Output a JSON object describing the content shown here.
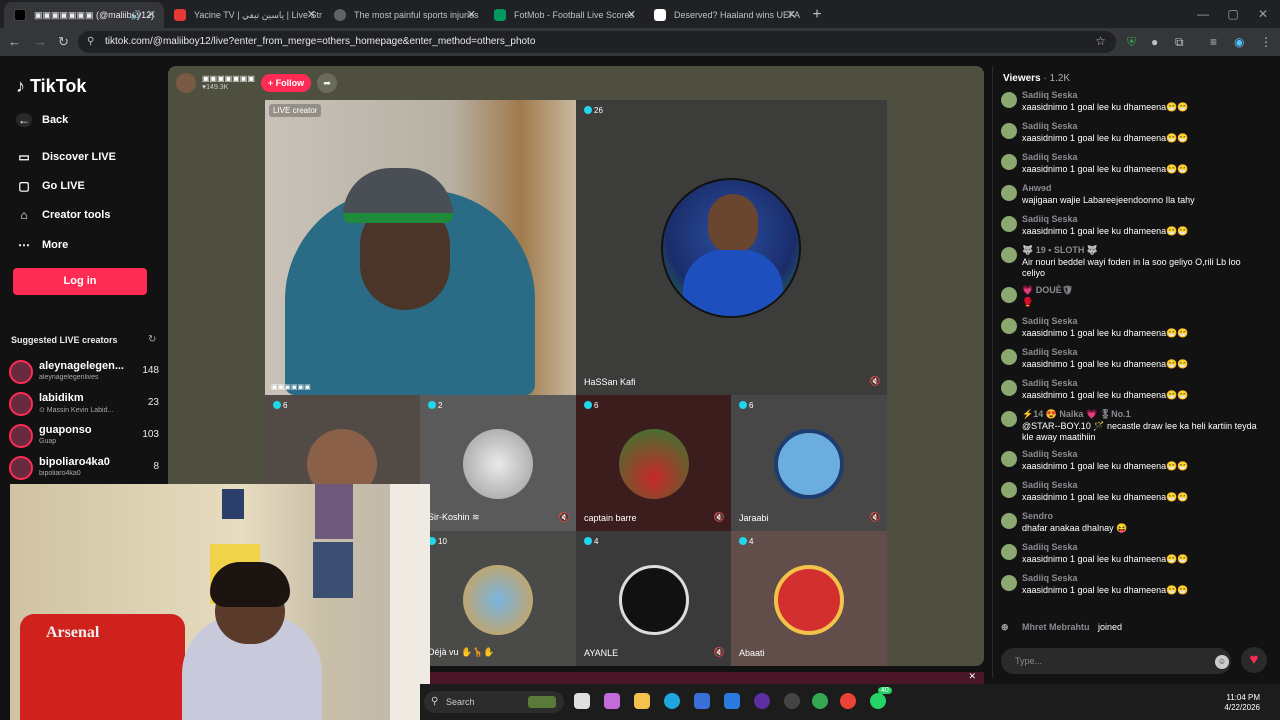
{
  "browser": {
    "tabs": [
      {
        "title": "▣▣▣▣▣▣▣ (@maliiboy12)",
        "color": "#000000",
        "active": true
      },
      {
        "title": "Yacine TV | ياسين تيفي | Live Str",
        "color": "#e53935",
        "active": false
      },
      {
        "title": "The most painful sports injuries",
        "color": "#5f6368",
        "active": false
      },
      {
        "title": "FotMob - Football Live Scores",
        "color": "#00985f",
        "active": false
      },
      {
        "title": "Deserved? Haaland wins UEFA",
        "color": "#ffffff",
        "active": false
      }
    ],
    "url": "tiktok.com/@maliiboy12/live?enter_from_merge=others_homepage&enter_method=others_photo"
  },
  "sidebar": {
    "logo": "TikTok",
    "back": "Back",
    "items": [
      {
        "label": "Discover LIVE",
        "icon": "tv-icon"
      },
      {
        "label": "Go LIVE",
        "icon": "camera-icon"
      },
      {
        "label": "Creator tools",
        "icon": "home-icon"
      },
      {
        "label": "More",
        "icon": "dots-icon"
      }
    ],
    "login": "Log in",
    "suggested_title": "Suggested LIVE creators",
    "suggested": [
      {
        "name": "aleynagelegen...",
        "sub": "aleynagelegenlives",
        "count": "148"
      },
      {
        "name": "labidikm",
        "sub": "⊙ Massin Kevin Labid...",
        "count": "23"
      },
      {
        "name": "guaponso",
        "sub": "Guap",
        "count": "103"
      },
      {
        "name": "bipoliaro4ka0",
        "sub": "bipoliaro4ka0",
        "count": "8"
      }
    ]
  },
  "live": {
    "host_name": "▣▣▣▣▣▣▣",
    "host_likes": "♥149.3K",
    "follow": "+ Follow",
    "creator_badge": "LIVE creator",
    "creator_name": "▣▣▣▣▣▣",
    "guests": [
      {
        "count": "26",
        "name": "HaSSan Kafi"
      },
      {
        "count": "6",
        "name": ""
      },
      {
        "count": "2",
        "name": "Sir-Koshin ≋"
      },
      {
        "count": "6",
        "name": "captain barre"
      },
      {
        "count": "6",
        "name": "Jaraabi"
      },
      {
        "count": "10",
        "name": "Déjà vu ✋🦒✋"
      },
      {
        "count": "4",
        "name": "AYANLE"
      },
      {
        "count": "4",
        "name": "Abaati"
      }
    ]
  },
  "chat": {
    "viewers_label": "Viewers",
    "viewers_count": "· 1.2K",
    "messages": [
      {
        "user": "Sadiiq Seska",
        "text": "xaasidnimo 1 goal lee ku dhameena😁😁"
      },
      {
        "user": "Sadiiq Seska",
        "text": "xaasidnimo 1 goal lee ku dhameena😁😁"
      },
      {
        "user": "Sadiiq Seska",
        "text": "xaasidnimo 1 goal lee ku dhameena😁😁"
      },
      {
        "user": "Aнwɘd",
        "text": "wajigaan wajie Labareejeendoonno Ila tahy"
      },
      {
        "user": "Sadiiq Seska",
        "text": "xaasidnimo 1 goal lee ku dhameena😁😁"
      },
      {
        "user": "🐺 19 • SLOTH 🐺",
        "text": "Air nouri beddel wayi foden in la soo geliyo O,rili Lb loo celiyo"
      },
      {
        "user": "💗 DOUÈ🛡",
        "text": "🥊"
      },
      {
        "user": "Sadiiq Seska",
        "text": "xaasidnimo 1 goal lee ku dhameena😁😁"
      },
      {
        "user": "Sadiiq Seska",
        "text": "xaasidnimo 1 goal lee ku dhameena😁😁"
      },
      {
        "user": "Sadiiq Seska",
        "text": "xaasidnimo 1 goal lee ku dhameena😁😁"
      },
      {
        "user": "⚡14 😍 Nalka 💗 🎖No.1",
        "text": "@STAR--BOY.10 🪄 necastle draw lee ka heli kartiin teyda kle away maatihiin"
      },
      {
        "user": "Sadiiq Seska",
        "text": "xaasidnimo 1 goal lee ku dhameena😁😁"
      },
      {
        "user": "Sadiiq Seska",
        "text": "xaasidnimo 1 goal lee ku dhameena😁😁"
      },
      {
        "user": "Sendro",
        "text": "dhafar anakaa dhalnay 😝"
      },
      {
        "user": "Sadiiq Seska",
        "text": "xaasidnimo 1 goal lee ku dhameena😁😁"
      },
      {
        "user": "Sadiiq Seska",
        "text": "xaasidnimo 1 goal lee ku dhameena😁😁"
      }
    ],
    "joined_user": "Mhret Mebrahtu",
    "joined_text": "joined",
    "placeholder": "Type..."
  },
  "taskbar": {
    "search": "Search",
    "badge": "40",
    "time": "11:04 PM",
    "date": "4/22/2026"
  }
}
